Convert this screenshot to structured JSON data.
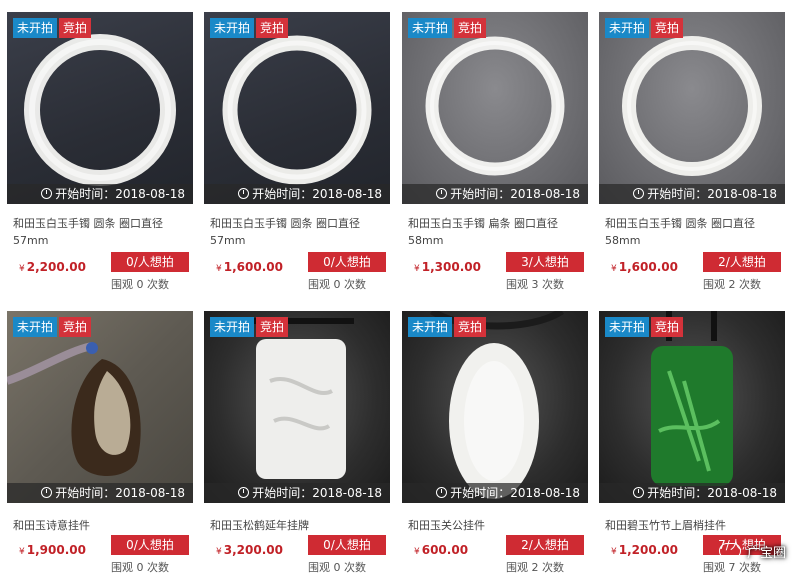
{
  "products": [
    {
      "status": "未开拍",
      "type": "竞拍",
      "start": "开始时间：2018-08-18",
      "title": "和田玉白玉手镯 圆条 圈口直径57mm",
      "price": "2,200.00",
      "want": "0/人想拍",
      "views": "围观 0 次数",
      "image": "bangle"
    },
    {
      "status": "未开拍",
      "type": "竞拍",
      "start": "开始时间：2018-08-18",
      "title": "和田玉白玉手镯 圆条 圈口直径57mm",
      "price": "1,600.00",
      "want": "0/人想拍",
      "views": "围观 0 次数",
      "image": "bangle"
    },
    {
      "status": "未开拍",
      "type": "竞拍",
      "start": "开始时间：2018-08-18",
      "title": "和田玉白玉手镯 扁条 圈口直径58mm",
      "price": "1,300.00",
      "want": "3/人想拍",
      "views": "围观 3 次数",
      "image": "bangle"
    },
    {
      "status": "未开拍",
      "type": "竞拍",
      "start": "开始时间：2018-08-18",
      "title": "和田玉白玉手镯 圆条 圈口直径58mm",
      "price": "1,600.00",
      "want": "2/人想拍",
      "views": "围观 2 次数",
      "image": "bangle"
    },
    {
      "status": "未开拍",
      "type": "竞拍",
      "start": "开始时间：2018-08-18",
      "title": "和田玉诗意挂件",
      "price": "1,900.00",
      "want": "0/人想拍",
      "views": "围观 0 次数",
      "image": "pendant-brown"
    },
    {
      "status": "未开拍",
      "type": "竞拍",
      "start": "开始时间：2018-08-18",
      "title": "和田玉松鹤延年挂牌",
      "price": "3,200.00",
      "want": "0/人想拍",
      "views": "围观 0 次数",
      "image": "plaque-white"
    },
    {
      "status": "未开拍",
      "type": "竞拍",
      "start": "开始时间：2018-08-18",
      "title": "和田玉关公挂件",
      "price": "600.00",
      "want": "2/人想拍",
      "views": "围观 2 次数",
      "image": "pendant-white"
    },
    {
      "status": "未开拍",
      "type": "竞拍",
      "start": "开始时间：2018-08-18",
      "title": "和田碧玉竹节上眉梢挂件",
      "price": "1,200.00",
      "want": "7/人想拍",
      "views": "围观 7 次数",
      "image": "plaque-green"
    }
  ],
  "currency_symbol": "¥",
  "watermark": "广宝圈"
}
